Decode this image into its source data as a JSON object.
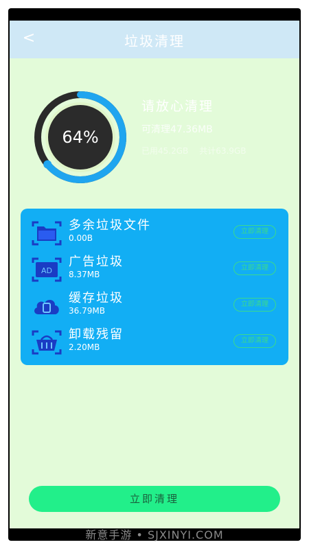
{
  "header": {
    "back_glyph": "<",
    "title": "垃圾清理"
  },
  "summary": {
    "percent_label": "64%",
    "percent_value": 0.64,
    "headline": "请放心清理",
    "cleanable": "可清理47.36MB",
    "storage_used": "已用45.2GB",
    "storage_total": "共计63.9GB"
  },
  "categories": [
    {
      "name": "多余垃圾文件",
      "size": "0.00B",
      "button": "立即清理",
      "icon": "folder-icon"
    },
    {
      "name": "广告垃圾",
      "size": "8.37MB",
      "button": "立即清理",
      "icon": "ad-icon"
    },
    {
      "name": "缓存垃圾",
      "size": "36.79MB",
      "button": "立即清理",
      "icon": "cache-cloud-icon"
    },
    {
      "name": "卸载残留",
      "size": "2.20MB",
      "button": "立即清理",
      "icon": "basket-icon"
    }
  ],
  "footer": {
    "clean_button": "立即清理"
  },
  "watermark": "新意手游 • SJXINYI.COM",
  "colors": {
    "accent": "#12aef4",
    "ring": "#1fa5ef",
    "button": "#22ef8a",
    "background": "#e3fbd9"
  }
}
